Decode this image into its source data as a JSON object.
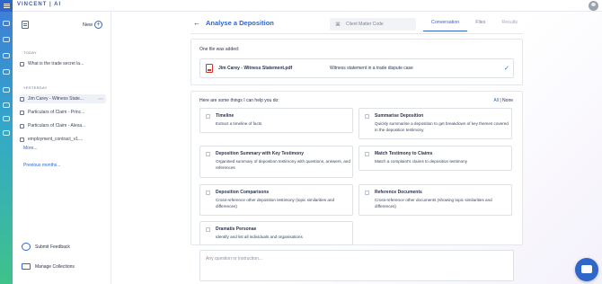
{
  "app": {
    "brand": "VINCENT | AI"
  },
  "sidebar": {
    "new_label": "New",
    "sections": {
      "today": "TODAY",
      "yesterday": "YESTERDAY"
    },
    "today_items": [
      {
        "label": "What is the trade secret la..."
      }
    ],
    "yesterday_items": [
      {
        "label": "Jim Carey - Witness State...",
        "active": true
      },
      {
        "label": "Particulars of Claim - Princ..."
      },
      {
        "label": "Particulars of Claim - Alexa..."
      },
      {
        "label": "employment_contract_v1...."
      }
    ],
    "more_label": "More...",
    "previous_label": "Previous months...",
    "bottom": {
      "feedback": "Submit Feedback",
      "collections": "Manage Collections"
    }
  },
  "main": {
    "title": "Analyse a Deposition",
    "matter_placeholder": "Client Matter Code",
    "tabs": [
      {
        "label": "Conversation",
        "state": "active"
      },
      {
        "label": "Files",
        "state": "normal"
      },
      {
        "label": "Results",
        "state": "disabled"
      }
    ],
    "added_label": "One file was added:",
    "file": {
      "name": "Jim Carey - Witness Statement.pdf",
      "description": "Witness statement in a trade dispute case"
    },
    "help_label": "Here are some things I can help you do:",
    "all_label": "All",
    "separator": "|",
    "none_label": "None",
    "options": [
      {
        "title": "Timeline",
        "desc": "Extract a timeline of facts"
      },
      {
        "title": "Summarise Deposition",
        "desc": "Quickly summarise a deposition to get breakdown of key themes covered in the deposition testimony"
      },
      {
        "title": "Deposition Summary with Key Testimony",
        "desc": "Organised summary of deposition testimony with questions, answers, and references"
      },
      {
        "title": "Match Testimony to Claims",
        "desc": "Match a complaint's claims to deposition testimony"
      },
      {
        "title": "Deposition Comparisons",
        "desc": "Cross-reference other deposition testimony (topic similarities and differences)"
      },
      {
        "title": "Reference Documents",
        "desc": "Cross-reference other documents (showing topic similarities and differences)"
      },
      {
        "title": "Dramatis Personae",
        "desc": "Identify and list all individuals and organisations"
      }
    ],
    "ask_placeholder": "Any question or instruction..."
  },
  "colors": {
    "accent": "#2f66c9",
    "rail_top": "#3e7fd7",
    "rail_bottom": "#3fc28a"
  }
}
